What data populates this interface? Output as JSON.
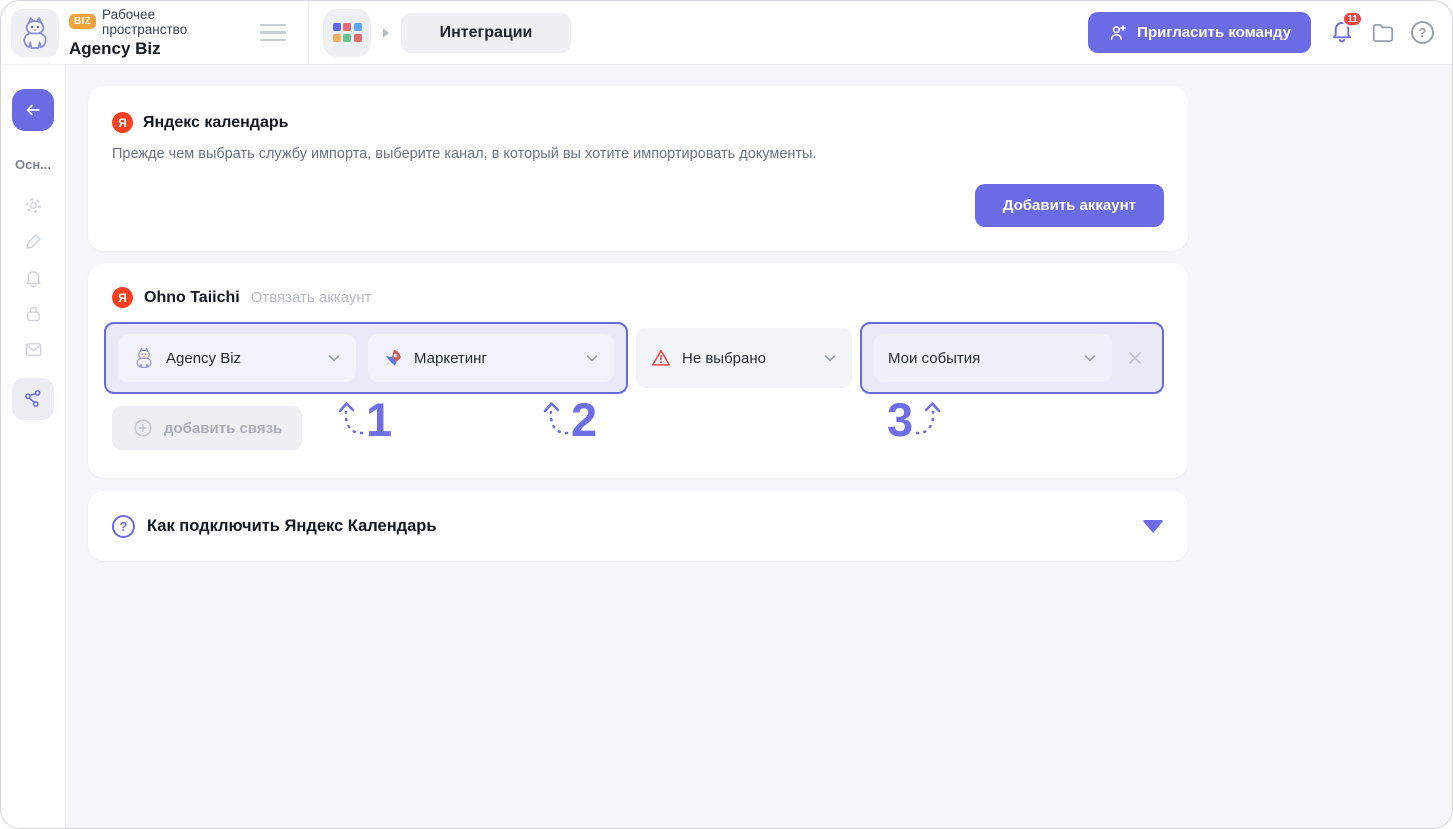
{
  "header": {
    "workspace": {
      "badge": "BIZ",
      "label": "Рабочее пространство",
      "name": "Agency Biz"
    },
    "nav": {
      "current": "Интеграции"
    },
    "invite_label": "Пригласить команду",
    "notifications_count": "11",
    "icons": [
      "apps-grid-icon",
      "bell-icon",
      "folder-icon",
      "help-icon",
      "menu-icon"
    ]
  },
  "sidebar": {
    "section_label": "Осн...",
    "back_icon": "arrow-left-icon",
    "items": [
      "settings-gear-icon",
      "brush-icon",
      "bell-icon",
      "lock-icon",
      "mail-icon",
      "integrations-share-icon"
    ],
    "active_item": "integrations-share-icon"
  },
  "integration": {
    "yandex_glyph": "Я",
    "title": "Яндекс календарь",
    "description": "Прежде чем выбрать службу импорта, выберите канал, в который вы хотите импортировать документы.",
    "add_account_label": "Добавить аккаунт"
  },
  "account": {
    "name": "Ohno Taiichi",
    "unlink_label": "Отвязать аккаунт",
    "selects": {
      "workspace": {
        "value": "Agency Biz",
        "icon": "cat-logo-icon"
      },
      "channel": {
        "value": "Маркетинг",
        "icon": "rocket-icon"
      },
      "target": {
        "value": "Не выбрано",
        "icon": "warning-triangle-icon"
      },
      "calendar": {
        "value": "Мои события"
      }
    },
    "add_link_label": "добавить связь",
    "steps": {
      "one": "1",
      "two": "2",
      "three": "3"
    }
  },
  "help": {
    "title": "Как подключить Яндекс Календарь",
    "icon_glyph": "?"
  },
  "colors": {
    "accent": "#6B6BE5",
    "yandex_red": "#FC3F1D",
    "biz_badge": "#F1A33C",
    "notification_red": "#EF4444",
    "warning_red": "#E5484D",
    "main_bg": "#F5F6F8"
  }
}
